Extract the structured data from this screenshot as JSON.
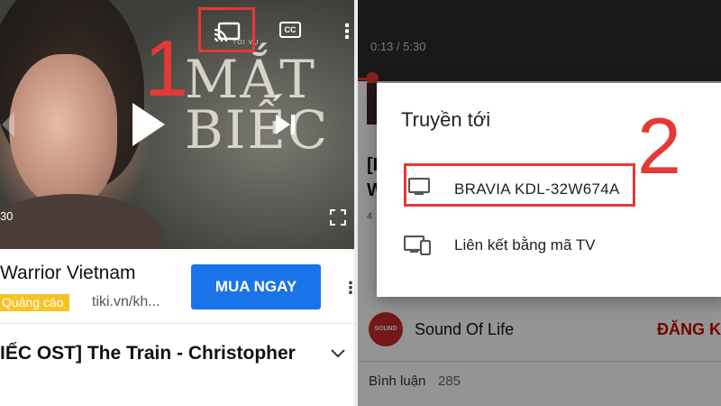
{
  "left_pane": {
    "poster": {
      "credit_small": "TÔI VỤ",
      "title_line1": "MẮT",
      "title_line2": "BIẾC"
    },
    "player": {
      "time_partial": "30",
      "step_number": "1"
    },
    "ad": {
      "title": "Warrior Vietnam",
      "badge": "Quảng cáo",
      "url": "tiki.vn/kh...",
      "button_label": "MUA NGAY"
    },
    "video_title": "IẾC OST] The Train - Christopher"
  },
  "right_pane": {
    "player": {
      "time": "0:13 / 5:30",
      "progress_fraction": 0.04
    },
    "background": {
      "title_partial_line1": "[I",
      "title_partial_line2": "W",
      "views_partial": "4"
    },
    "cast_dialog": {
      "title": "Truyền tới",
      "device_name": "BRAVIA KDL-32W674A",
      "link_option": "Liên kết bằng mã TV",
      "step_number": "2"
    },
    "channel": {
      "avatar_text": "SOUND",
      "name": "Sound Of Life",
      "subscribe_label": "ĐĂNG K"
    },
    "comments": {
      "label": "Bình luận",
      "count": "285"
    }
  },
  "colors": {
    "annotation_red": "#e53935",
    "button_blue": "#1a73e8",
    "badge_yellow": "#f6c325",
    "subscribe_red": "#cc0000"
  }
}
